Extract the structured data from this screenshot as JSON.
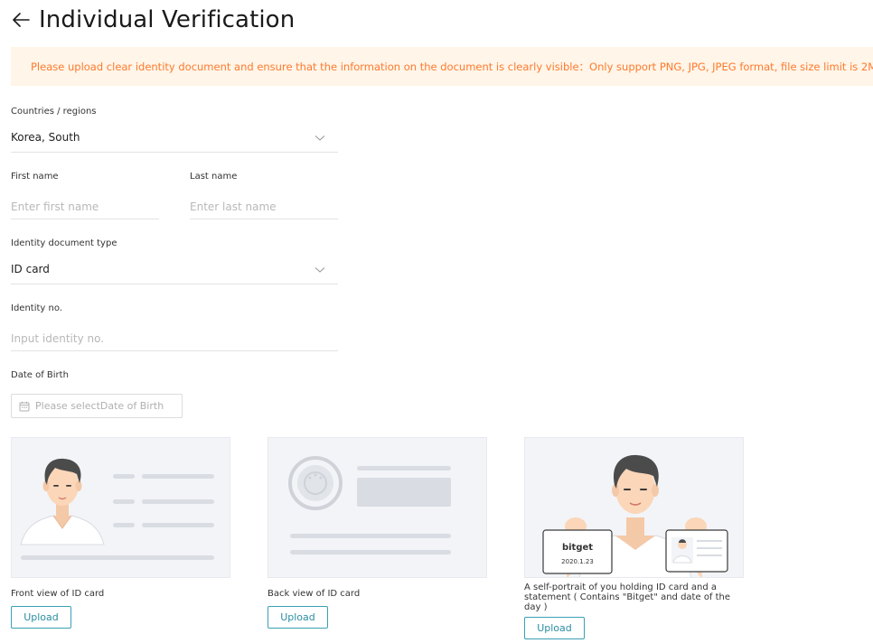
{
  "header": {
    "title": "Individual Verification",
    "back_icon": "arrow-left-icon"
  },
  "notice": {
    "text": "Please upload clear identity document and ensure that the information on the document is clearly visible：Only support PNG, JPG, JPEG format, file size limit is 2M",
    "icon": "warning-icon",
    "color": "#ff7a2e",
    "background": "#fff5e8"
  },
  "form": {
    "country": {
      "label": "Countries / regions",
      "value": "Korea, South"
    },
    "first_name": {
      "label": "First name",
      "placeholder": "Enter first name"
    },
    "last_name": {
      "label": "Last name",
      "placeholder": "Enter last name"
    },
    "doc_type": {
      "label": "Identity document type",
      "value": "ID card"
    },
    "identity_no": {
      "label": "Identity no.",
      "placeholder": "Input identity no."
    },
    "dob": {
      "label": "Date of Birth",
      "placeholder": "Please selectDate of Birth"
    }
  },
  "uploads": [
    {
      "caption": "Front view of ID card",
      "button": "Upload"
    },
    {
      "caption": "Back view of ID card",
      "button": "Upload"
    },
    {
      "caption": "A self-portrait of you holding ID card and a statement ( Contains \"Bitget\" and date of the day )",
      "button": "Upload"
    }
  ],
  "selfie_card": {
    "brand": "bitget",
    "date": "2020.1.23"
  },
  "colors": {
    "accent": "#2b8ea3",
    "card_bg": "#f2f4f7"
  }
}
